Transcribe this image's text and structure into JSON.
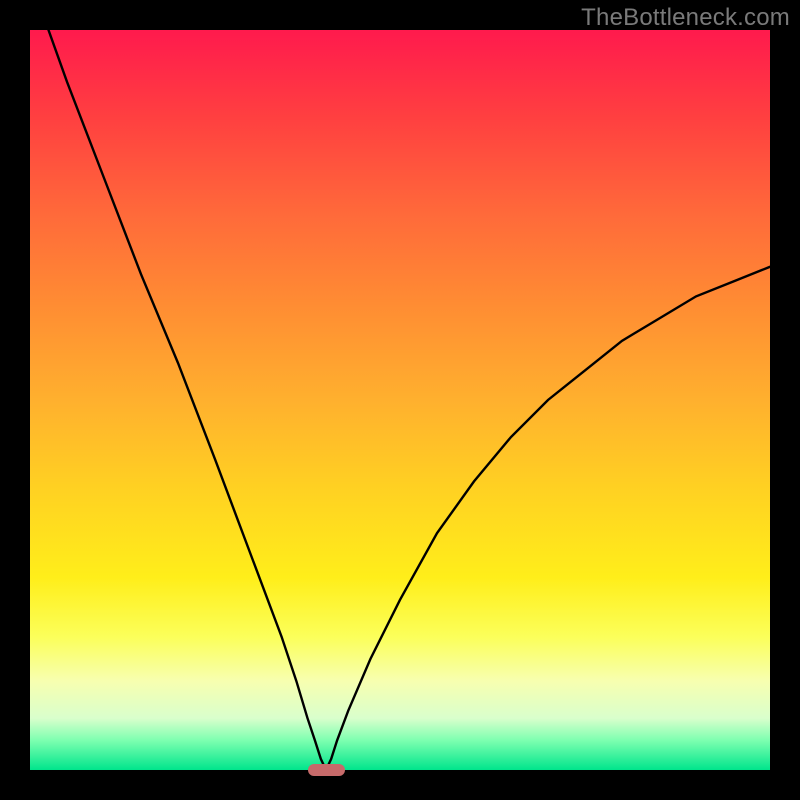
{
  "watermark": {
    "text": "TheBottleneck.com"
  },
  "colors": {
    "gradient_top": "#ff1a4d",
    "gradient_bottom": "#00e58c",
    "curve": "#000000",
    "marker": "#c66a6a",
    "frame": "#000000"
  },
  "chart_data": {
    "type": "line",
    "title": "",
    "xlabel": "",
    "ylabel": "",
    "xlim": [
      0,
      100
    ],
    "ylim": [
      0,
      100
    ],
    "legend": false,
    "grid": false,
    "series": [
      {
        "name": "bottleneck-curve",
        "x": [
          0,
          5,
          10,
          15,
          20,
          25,
          28,
          31,
          34,
          36,
          37.5,
          38.5,
          39.3,
          40,
          40.7,
          41.5,
          43,
          46,
          50,
          55,
          60,
          65,
          70,
          75,
          80,
          85,
          90,
          95,
          100
        ],
        "y": [
          107,
          93,
          80,
          67,
          55,
          42,
          34,
          26,
          18,
          12,
          7,
          4,
          1.5,
          0,
          1.5,
          4,
          8,
          15,
          23,
          32,
          39,
          45,
          50,
          54,
          58,
          61,
          64,
          66,
          68
        ]
      }
    ],
    "marker": {
      "x": 40,
      "y": 0,
      "width": 5,
      "height": 1.6
    }
  }
}
